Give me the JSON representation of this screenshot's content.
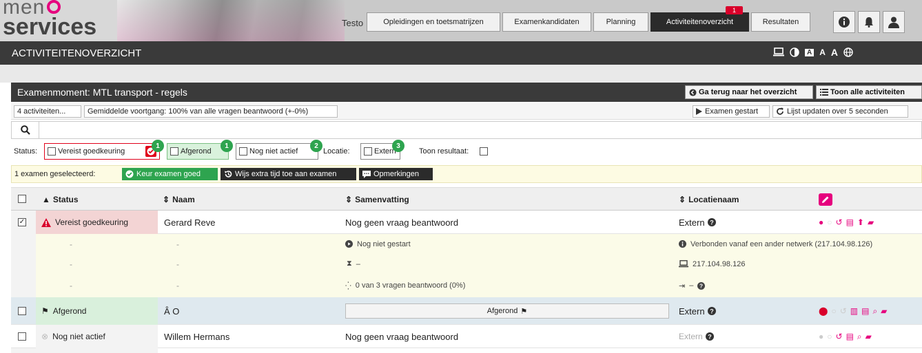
{
  "header": {
    "logo_line1": "men",
    "logo_line2": "services",
    "site_text": "Testo",
    "nav": [
      {
        "label": "Opleidingen en toetsmatrijzen"
      },
      {
        "label": "Examenkandidaten"
      },
      {
        "label": "Planning"
      },
      {
        "label": "Activiteitenoverzicht",
        "badge": "1"
      },
      {
        "label": "Resultaten"
      }
    ],
    "icons": [
      "info-icon",
      "bell-icon",
      "user-icon"
    ]
  },
  "titlebar": {
    "title": "ACTIVITEITENOVERZICHT",
    "text_size_a": "A"
  },
  "panel": {
    "title": "Examenmoment: MTL transport - regels",
    "back_button": "Ga terug naar het overzicht",
    "show_all_button": "Toon alle activiteiten",
    "activities_count": "4 activiteiten...",
    "progress": "Gemiddelde voortgang: 100% van alle vragen beantwoord (+-0%)",
    "exam_started": "Examen gestart",
    "list_update": "Lijst updaten over 5 seconden",
    "search_placeholder": "",
    "status_label": "Status:",
    "filters": [
      {
        "label": "Vereist goedkeuring",
        "badge": "1"
      },
      {
        "label": "Afgerond",
        "badge": "1"
      },
      {
        "label": "Nog niet actief",
        "badge": "2"
      }
    ],
    "location_label": "Locatie:",
    "location_filter": {
      "label": "Extern",
      "badge": "3"
    },
    "show_result_label": "Toon resultaat:",
    "selected_text": "1 examen geselecteerd:",
    "actions": {
      "approve": "Keur examen goed",
      "extra_time": "Wijs extra tijd toe aan examen",
      "remarks": "Opmerkingen"
    }
  },
  "table": {
    "columns": {
      "status": "Status",
      "name": "Naam",
      "summary": "Samenvatting",
      "location": "Locatienaam"
    },
    "rows": [
      {
        "status": "Vereist goedkeuring",
        "name": "Gerard Reve",
        "summary": "Nog geen vraag beantwoord",
        "location": "Extern"
      },
      {
        "dash": "-",
        "summary": "Nog niet gestart",
        "location": "Verbonden vanaf een ander netwerk (217.104.98.126)"
      },
      {
        "dash": "-",
        "summary": "–",
        "location": "217.104.98.126"
      },
      {
        "dash": "-",
        "summary": "0 van 3 vragen beantwoord (0%)",
        "location": "–"
      },
      {
        "status": "Afgerond",
        "name": "Â O",
        "summary": "Afgerond",
        "location": "Extern"
      },
      {
        "status": "Nog niet actief",
        "name": "Willem Hermans",
        "summary": "Nog geen vraag beantwoord",
        "location": "Extern"
      }
    ]
  },
  "colors": {
    "accent": "#e6007e",
    "dark": "#3a3a3a",
    "green": "#2ea44f",
    "red": "#d9002b"
  }
}
